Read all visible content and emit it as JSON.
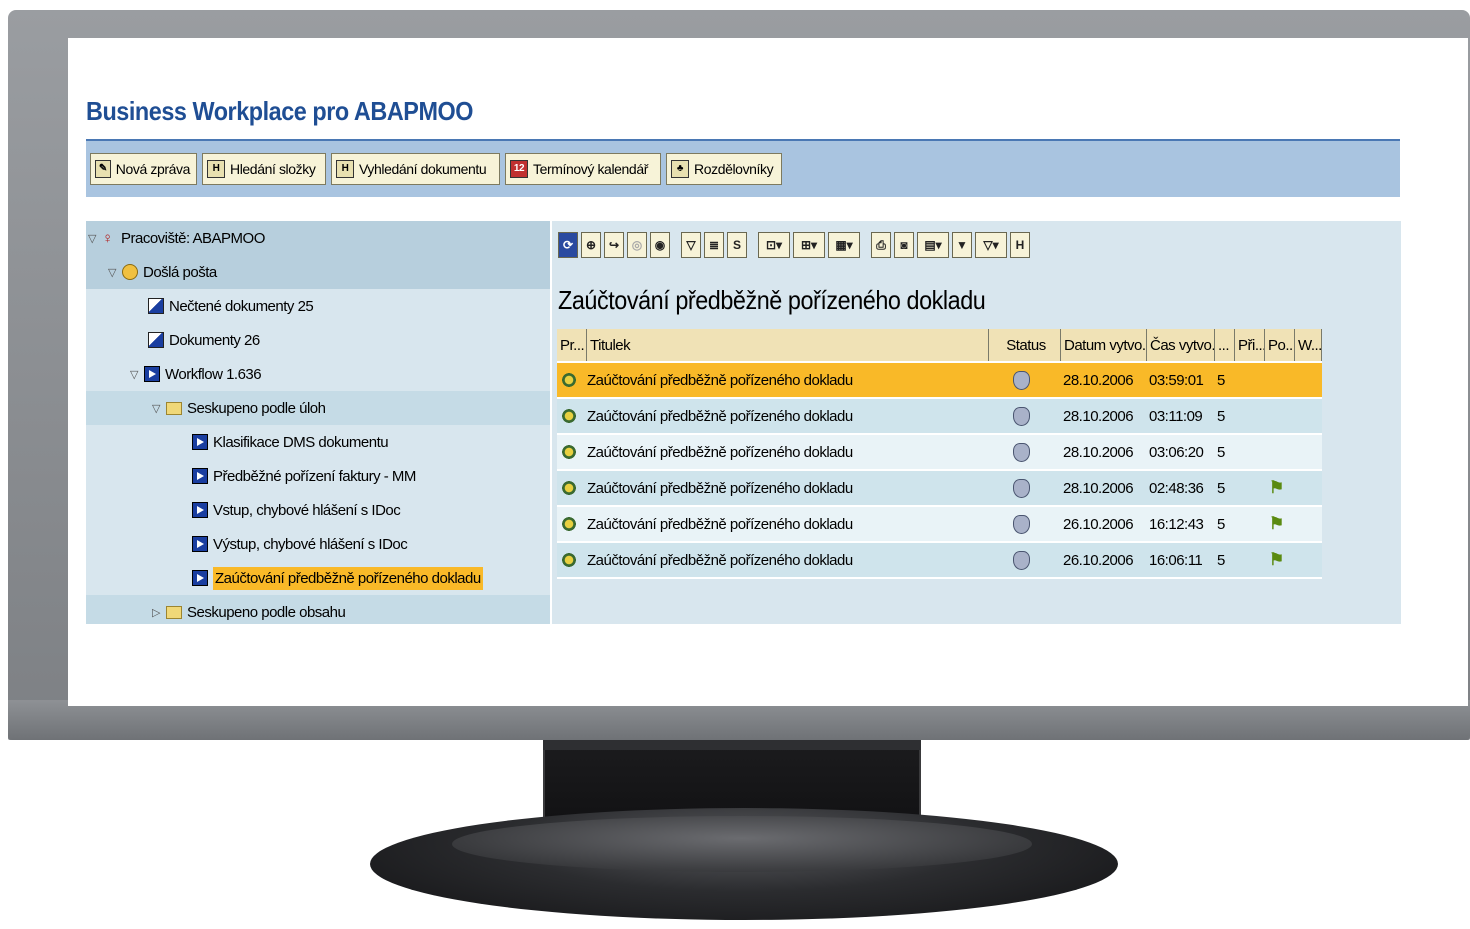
{
  "app": {
    "title": "Business Workplace pro ABAPMOO"
  },
  "toolbar": {
    "buttons": [
      {
        "label": "Nová zpráva",
        "icon": "new-message-icon"
      },
      {
        "label": "Hledání složky",
        "icon": "binoculars-icon"
      },
      {
        "label": "Vyhledání dokumentu",
        "icon": "binoculars-icon"
      },
      {
        "label": "Termínový kalendář",
        "icon": "calendar-icon"
      },
      {
        "label": "Rozdělovníky",
        "icon": "distribution-list-icon"
      }
    ]
  },
  "tree": {
    "items": [
      {
        "label": "Pracoviště: ABAPMOO",
        "icon": "workplace-person-icon",
        "toggle": "▽"
      },
      {
        "label": "Došlá pošta",
        "icon": "inbox-icon",
        "toggle": "▽"
      },
      {
        "label": "Nečtené dokumenty 25",
        "icon": "document-icon",
        "toggle": ""
      },
      {
        "label": "Dokumenty 26",
        "icon": "document-icon",
        "toggle": ""
      },
      {
        "label": "Workflow 1.636",
        "icon": "workflow-icon",
        "toggle": "▽"
      },
      {
        "label": "Seskupeno podle úloh",
        "icon": "folder-icon",
        "toggle": "▽"
      },
      {
        "label": "Klasifikace DMS dokumentu",
        "icon": "workflow-icon",
        "toggle": ""
      },
      {
        "label": "Předběžné pořízení faktury - MM",
        "icon": "workflow-icon",
        "toggle": ""
      },
      {
        "label": "Vstup, chybové hlášení s IDoc",
        "icon": "workflow-icon",
        "toggle": ""
      },
      {
        "label": "Výstup, chybové hlášení s IDoc",
        "icon": "workflow-icon",
        "toggle": ""
      },
      {
        "label": "Zaúčtování předběžně pořízeného dokladu",
        "icon": "workflow-icon",
        "toggle": ""
      },
      {
        "label": "Seskupeno podle obsahu",
        "icon": "folder-icon",
        "toggle": "▷"
      }
    ]
  },
  "content": {
    "title": "Zaúčtování předběžně pořízeného dokladu",
    "toolbar_icons": [
      "refresh-icon",
      "execute-icon",
      "forward-icon",
      "disabled-icon",
      "settings-icon",
      "filter-icon",
      "sort-icon",
      "export-icon",
      "move-icon",
      "attach-icon",
      "layout-icon",
      "print-icon",
      "preview-icon",
      "columns-icon",
      "filter2-icon",
      "filter3-icon",
      "find-icon"
    ],
    "columns": [
      "Pr...",
      "Titulek",
      "Status",
      "Datum vytvo...",
      "Čas vytvo...",
      "...",
      "Při...",
      "Po...",
      "W..."
    ],
    "rows": [
      {
        "title": "Zaúčtování předběžně pořízeného dokladu",
        "date": "28.10.2006",
        "time": "03:59:01",
        "priority": "5",
        "flag": ""
      },
      {
        "title": "Zaúčtování předběžně pořízeného dokladu",
        "date": "28.10.2006",
        "time": "03:11:09",
        "priority": "5",
        "flag": ""
      },
      {
        "title": "Zaúčtování předběžně pořízeného dokladu",
        "date": "28.10.2006",
        "time": "03:06:20",
        "priority": "5",
        "flag": ""
      },
      {
        "title": "Zaúčtování předběžně pořízeného dokladu",
        "date": "28.10.2006",
        "time": "02:48:36",
        "priority": "5",
        "flag": "⚑"
      },
      {
        "title": "Zaúčtování předběžně pořízeného dokladu",
        "date": "26.10.2006",
        "time": "16:12:43",
        "priority": "5",
        "flag": "⚑"
      },
      {
        "title": "Zaúčtování předběžně pořízeného dokladu",
        "date": "26.10.2006",
        "time": "16:06:11",
        "priority": "5",
        "flag": "⚑"
      }
    ]
  }
}
